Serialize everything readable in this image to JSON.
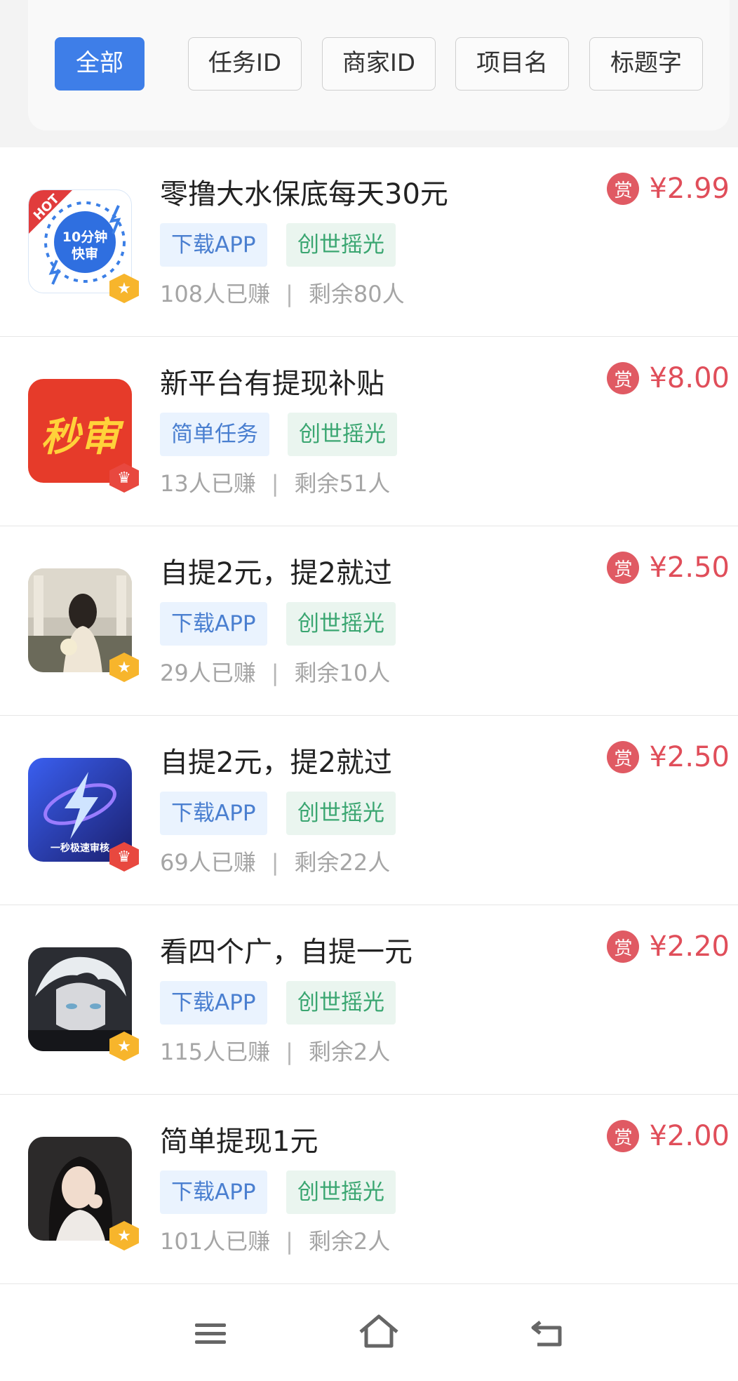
{
  "filters": [
    {
      "label": "全部",
      "active": true
    },
    {
      "label": "任务ID"
    },
    {
      "label": "商家ID"
    },
    {
      "label": "项目名"
    },
    {
      "label": "标题字"
    }
  ],
  "tasks": [
    {
      "title": "零撸大水保底每天30元",
      "tags": [
        "下载APP",
        "创世摇光"
      ],
      "earned": "108人已赚",
      "remaining": "剩余80人",
      "reward_icon": "赏",
      "price": "¥2.99",
      "icon": {
        "type": "fast-review-logo",
        "hot": "HOT",
        "text_line1": "10分钟",
        "text_line2": "快审"
      },
      "badge": "star"
    },
    {
      "title": "新平台有提现补贴",
      "tags": [
        "简单任务",
        "创世摇光"
      ],
      "earned": "13人已赚",
      "remaining": "剩余51人",
      "reward_icon": "赏",
      "price": "¥8.00",
      "icon": {
        "type": "instant-review-logo",
        "text": "秒审"
      },
      "badge": "crown"
    },
    {
      "title": "自提2元，提2就过",
      "tags": [
        "下载APP",
        "创世摇光"
      ],
      "earned": "29人已赚",
      "remaining": "剩余10人",
      "reward_icon": "赏",
      "price": "¥2.50",
      "icon": {
        "type": "photo-woman-garden"
      },
      "badge": "star"
    },
    {
      "title": "自提2元，提2就过",
      "tags": [
        "下载APP",
        "创世摇光"
      ],
      "earned": "69人已赚",
      "remaining": "剩余22人",
      "reward_icon": "赏",
      "price": "¥2.50",
      "icon": {
        "type": "lightning-logo",
        "text": "一秒极速审核"
      },
      "badge": "crown"
    },
    {
      "title": "看四个广，自提一元",
      "tags": [
        "下载APP",
        "创世摇光"
      ],
      "earned": "115人已赚",
      "remaining": "剩余2人",
      "reward_icon": "赏",
      "price": "¥2.20",
      "icon": {
        "type": "anime-white-hair"
      },
      "badge": "star"
    },
    {
      "title": "简单提现1元",
      "tags": [
        "下载APP",
        "创世摇光"
      ],
      "earned": "101人已赚",
      "remaining": "剩余2人",
      "reward_icon": "赏",
      "price": "¥2.00",
      "icon": {
        "type": "photo-woman-portrait"
      },
      "badge": "star"
    }
  ],
  "stats_separator": "|",
  "colors": {
    "accent": "#3e7ee8",
    "price": "#e04e5a",
    "tag_blue_text": "#4a7fd0",
    "tag_green_text": "#3aa671"
  },
  "nav": {
    "menu_icon": "menu-icon",
    "home_icon": "home-icon",
    "back_icon": "back-icon"
  }
}
